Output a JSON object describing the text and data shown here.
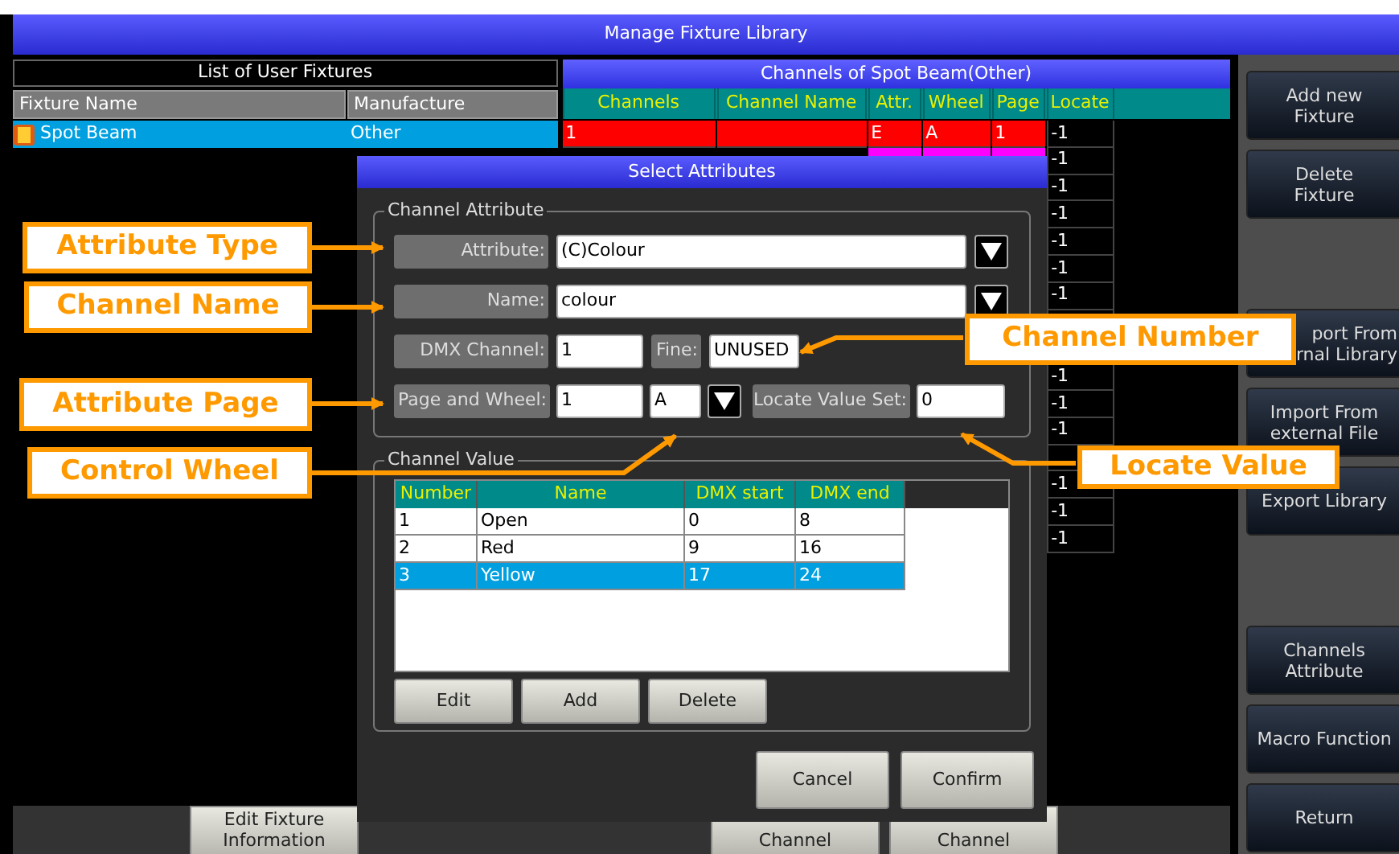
{
  "window": {
    "title": "Manage Fixture Library"
  },
  "fixtures": {
    "title": "List of User Fixtures",
    "columns": [
      "Fixture Name",
      "Manufacture"
    ],
    "rows": [
      {
        "name": "Spot Beam",
        "manufacture": "Other",
        "selected": true
      }
    ]
  },
  "channels": {
    "title": "Channels of Spot Beam(Other)",
    "columns": [
      "Channels",
      "Channel Name",
      "Attr.",
      "Wheel",
      "Page",
      "Locate"
    ],
    "rows": [
      {
        "channel": "1",
        "attr": "E",
        "wheel": "A",
        "page": "1",
        "locate": "-1",
        "color": "#ff0000"
      },
      {
        "locate": "-1",
        "color": "#ff00ff"
      },
      {
        "locate": "-1"
      },
      {
        "locate": "-1"
      },
      {
        "locate": "-1"
      },
      {
        "locate": "-1"
      },
      {
        "locate": "-1"
      },
      {},
      {},
      {
        "locate": "-1"
      },
      {
        "locate": "-1"
      },
      {
        "locate": "-1"
      },
      {},
      {
        "locate": "-1"
      },
      {
        "locate": "-1"
      },
      {
        "locate": "-1"
      }
    ]
  },
  "side_buttons": [
    [
      [
        "Add new",
        "Fixture"
      ],
      [
        "Delete",
        "Fixture"
      ]
    ],
    [
      [
        "port From",
        "rnal Library"
      ],
      [
        "Import From",
        "external File"
      ],
      [
        "Export Library"
      ]
    ],
    [
      [
        "Channels",
        "Attribute"
      ],
      [
        "Macro Function"
      ],
      [
        "Return"
      ]
    ]
  ],
  "bottom_buttons": [
    [
      "Edit Fixture",
      "Information"
    ],
    [
      "Channel"
    ],
    [
      "Channel"
    ]
  ],
  "dialog": {
    "title": "Select Attributes",
    "attribute_group": {
      "title": "Channel Attribute",
      "attribute": {
        "label": "Attribute:",
        "value": "(C)Colour"
      },
      "name": {
        "label": "Name:",
        "value": "colour"
      },
      "dmx_channel": {
        "label": "DMX Channel:",
        "value": "1"
      },
      "fine": {
        "label": "Fine:",
        "value": "UNUSED"
      },
      "page_and_wheel": {
        "label": "Page and Wheel:",
        "page": "1",
        "wheel": "A"
      },
      "locate_value_set": {
        "label": "Locate Value Set:",
        "value": "0"
      }
    },
    "value_group": {
      "title": "Channel Value",
      "columns": [
        "Number",
        "Name",
        "DMX start",
        "DMX end"
      ],
      "rows": [
        {
          "number": "1",
          "name": "Open",
          "start": "0",
          "end": "8",
          "selected": false
        },
        {
          "number": "2",
          "name": "Red",
          "start": "9",
          "end": "16",
          "selected": false
        },
        {
          "number": "3",
          "name": "Yellow",
          "start": "17",
          "end": "24",
          "selected": true
        }
      ],
      "buttons": [
        "Edit",
        "Add",
        "Delete"
      ]
    },
    "buttons": [
      "Cancel",
      "Confirm"
    ]
  },
  "callouts": [
    "Attribute Type",
    "Channel Name",
    "Attribute Page",
    "Control Wheel",
    "Channel Number",
    "Locate Value"
  ]
}
